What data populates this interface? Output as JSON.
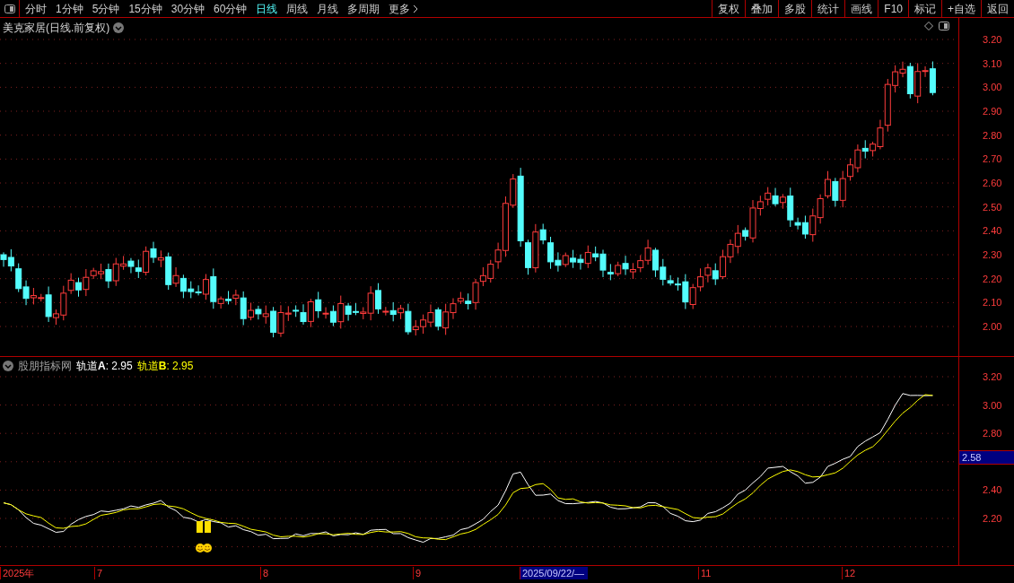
{
  "toolbar": {
    "periods": [
      {
        "label": "分时",
        "selected": false
      },
      {
        "label": "1分钟",
        "selected": false
      },
      {
        "label": "5分钟",
        "selected": false
      },
      {
        "label": "15分钟",
        "selected": false
      },
      {
        "label": "30分钟",
        "selected": false
      },
      {
        "label": "60分钟",
        "selected": false
      },
      {
        "label": "日线",
        "selected": true
      },
      {
        "label": "周线",
        "selected": false
      },
      {
        "label": "月线",
        "selected": false
      },
      {
        "label": "多周期",
        "selected": false
      },
      {
        "label": "更多",
        "selected": false
      }
    ],
    "actions": [
      "复权",
      "叠加",
      "多股",
      "统计",
      "画线",
      "F10",
      "标记",
      "+自选",
      "返回"
    ]
  },
  "main_chart": {
    "title": "美克家居(日线.前复权)",
    "price_axis": [
      "3.20",
      "3.10",
      "3.00",
      "2.90",
      "2.80",
      "2.70",
      "2.60",
      "2.50",
      "2.40",
      "2.30",
      "2.20",
      "2.10",
      "2.00"
    ]
  },
  "indicator": {
    "name": "股朋指标网",
    "series": [
      {
        "label": "轨道**A**",
        "value": ": 2.95",
        "color": "#ffffff"
      },
      {
        "label": "轨道**B**",
        "value": ": 2.95",
        "color": "#ffff00"
      }
    ],
    "axis": [
      "3.20",
      "3.00",
      "2.80",
      "2.40",
      "2.20"
    ],
    "cursor_value": "2.58"
  },
  "date_axis": [
    {
      "label": "2025年",
      "selected": false
    },
    {
      "label": "7",
      "selected": false
    },
    {
      "label": "8",
      "selected": false
    },
    {
      "label": "9",
      "selected": false
    },
    {
      "label": "2025/09/22/—",
      "selected": true
    },
    {
      "label": "11",
      "selected": false
    },
    {
      "label": "12",
      "selected": false
    }
  ]
}
